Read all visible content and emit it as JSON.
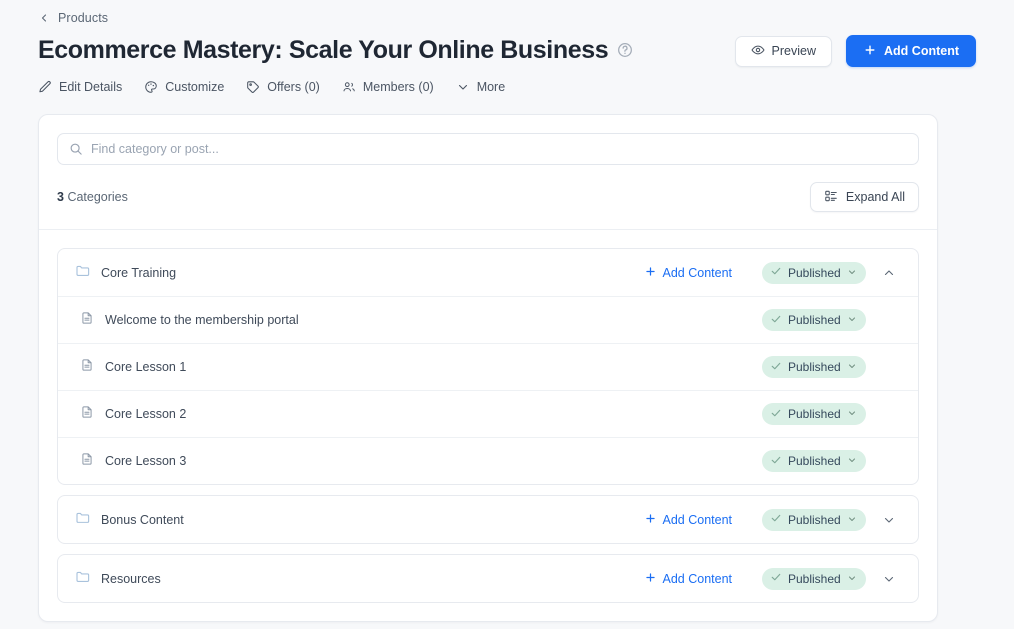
{
  "breadcrumb": {
    "label": "Products",
    "icon": "chevron-left-icon"
  },
  "header": {
    "title": "Ecommerce Mastery: Scale Your Online Business",
    "help_icon": "question-circle-icon",
    "preview_label": "Preview",
    "preview_icon": "eye-icon",
    "add_content_label": "Add Content",
    "add_content_icon": "plus-icon",
    "accent_color": "#1b6ef3"
  },
  "subnav": [
    {
      "label": "Edit Details",
      "icon": "pencil-icon"
    },
    {
      "label": "Customize",
      "icon": "palette-icon"
    },
    {
      "label": "Offers (0)",
      "icon": "tag-icon"
    },
    {
      "label": "Members (0)",
      "icon": "users-icon"
    },
    {
      "label": "More",
      "icon": "chevron-down-icon"
    }
  ],
  "search": {
    "value": "",
    "placeholder": "Find category or post...",
    "icon": "search-icon"
  },
  "toolbar": {
    "count": "3",
    "count_label": "Categories",
    "expand_all_label": "Expand All",
    "expand_all_icon": "layout-list-icon"
  },
  "status": {
    "published_label": "Published",
    "check_icon": "check-icon",
    "chevron_icon": "chevron-down-icon",
    "pill_bg": "#daf0e6"
  },
  "add_content_row_label": "Add Content",
  "categories": [
    {
      "name": "Core Training",
      "icon": "folder-icon",
      "expanded": true,
      "toggle_icon": "chevron-up-icon",
      "status": "Published",
      "lessons": [
        {
          "title": "Welcome to the membership portal",
          "icon": "document-icon",
          "status": "Published"
        },
        {
          "title": "Core Lesson 1",
          "icon": "document-icon",
          "status": "Published"
        },
        {
          "title": "Core Lesson 2",
          "icon": "document-icon",
          "status": "Published"
        },
        {
          "title": "Core Lesson 3",
          "icon": "document-icon",
          "status": "Published"
        }
      ]
    },
    {
      "name": "Bonus Content",
      "icon": "folder-icon",
      "expanded": false,
      "toggle_icon": "chevron-down-icon",
      "status": "Published",
      "lessons": []
    },
    {
      "name": "Resources",
      "icon": "folder-icon",
      "expanded": false,
      "toggle_icon": "chevron-down-icon",
      "status": "Published",
      "lessons": []
    }
  ]
}
